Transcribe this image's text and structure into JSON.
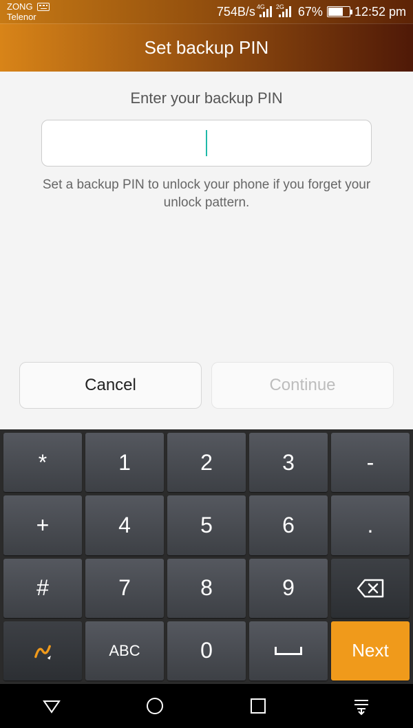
{
  "status": {
    "carrier1": "ZONG",
    "carrier2": "Telenor",
    "data_rate": "754B/s",
    "net1_label": "4G",
    "net2_label": "2G",
    "battery_pct": "67%",
    "time": "12:52 pm"
  },
  "title": "Set backup PIN",
  "content": {
    "subtitle": "Enter your backup PIN",
    "pin_value": "",
    "helper": "Set a backup PIN to unlock your phone if you forget your unlock pattern."
  },
  "buttons": {
    "cancel": "Cancel",
    "continue": "Continue"
  },
  "keypad": {
    "r1": {
      "c1": "*",
      "c2": "1",
      "c3": "2",
      "c4": "3",
      "c5": "-"
    },
    "r2": {
      "c1": "+",
      "c2": "4",
      "c3": "5",
      "c4": "6",
      "c5": "."
    },
    "r3": {
      "c1": "#",
      "c2": "7",
      "c3": "8",
      "c4": "9"
    },
    "r4": {
      "c2": "ABC",
      "c3": "0",
      "c5": "Next"
    }
  },
  "nav": {
    "back": "back",
    "home": "home",
    "recent": "recent",
    "ime": "ime-switch"
  }
}
